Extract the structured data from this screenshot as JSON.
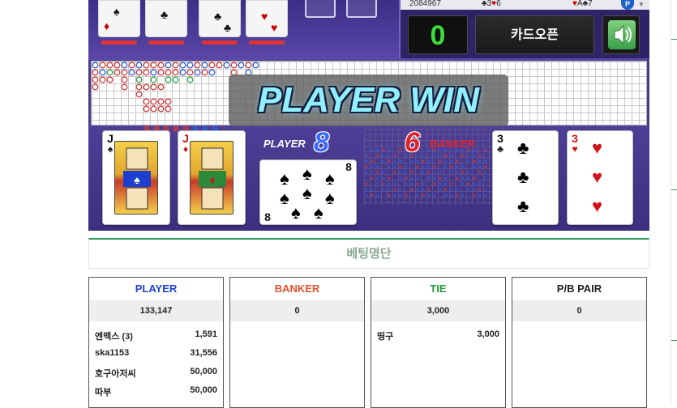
{
  "top": {
    "stats_value": "2084967",
    "banker_stat": "3",
    "player_stat": "6",
    "pair_stat": "7",
    "p_badge": "P",
    "counter": "0",
    "open_button": "카드오픈"
  },
  "result": {
    "banner": "PLAYER WIN",
    "player_label": "PLAYER",
    "player_score": "8",
    "banker_label": "BANKER",
    "banker_score": "6"
  },
  "cards": {
    "player": [
      {
        "rank": "J",
        "suit": "♠",
        "color": "#111111"
      },
      {
        "rank": "J",
        "suit": "♦",
        "color": "#d0141b"
      },
      {
        "rank": "8",
        "suit": "♠",
        "color": "#111111"
      }
    ],
    "banker": [
      {
        "rank": "3",
        "suit": "♣",
        "color": "#111111"
      },
      {
        "rank": "3",
        "suit": "♥",
        "color": "#d0141b"
      }
    ]
  },
  "betting": {
    "title": "베팅명단",
    "columns": [
      {
        "label": "PLAYER",
        "color": "#1c3fd0",
        "total": "133,147",
        "rows": [
          {
            "name": "엔맥스 (3)",
            "amount": "1,591"
          },
          {
            "name": "ska1153",
            "amount": "31,556"
          },
          {
            "name": "호구아저씨",
            "amount": "50,000"
          },
          {
            "name": "따부",
            "amount": "50,000"
          }
        ]
      },
      {
        "label": "BANKER",
        "color": "#e0532b",
        "total": "0",
        "rows": []
      },
      {
        "label": "TIE",
        "color": "#1f9a3a",
        "total": "3,000",
        "rows": [
          {
            "name": "띵구",
            "amount": "3,000"
          }
        ]
      },
      {
        "label": "P/B PAIR",
        "color": "#222222",
        "total": "0",
        "rows": []
      }
    ]
  },
  "colors": {
    "accent_green": "#2b9c5a",
    "player_blue": "#1c3fd0",
    "banker_red": "#e0532b",
    "panel_purple": "#4b3a8c"
  }
}
